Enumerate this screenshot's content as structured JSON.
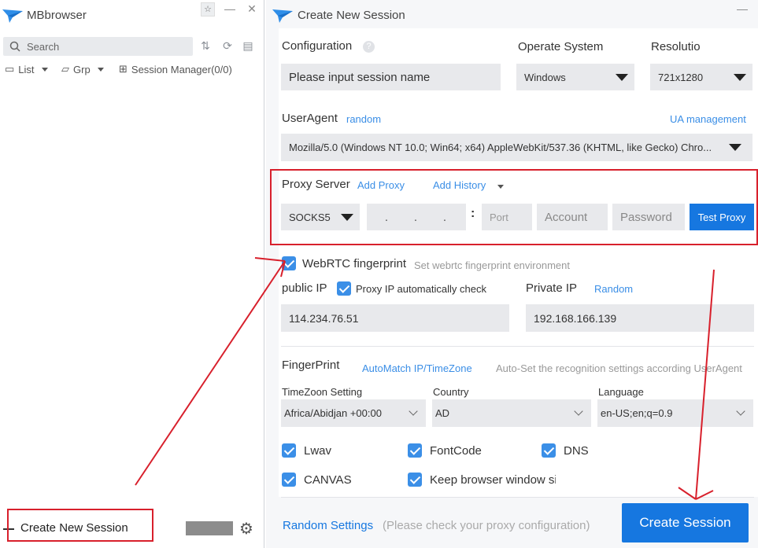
{
  "left": {
    "app_title": "MBbrowser",
    "search_placeholder": "Search",
    "view_list": "List",
    "view_group": "Grp",
    "session_manager": "Session Manager(0/0)",
    "create_new_session": "Create New Session"
  },
  "dialog": {
    "title": "Create New Session",
    "configuration_label": "Configuration",
    "session_name_placeholder": "Please input session name",
    "os_label": "Operate System",
    "os_value": "Windows",
    "resolution_label": "Resolutio",
    "resolution_value": "721x1280",
    "useragent_label": "UserAgent",
    "useragent_random": "random",
    "ua_management": "UA management",
    "useragent_value": "Mozilla/5.0 (Windows NT 10.0; Win64; x64) AppleWebKit/537.36 (KHTML, like Gecko) Chro...",
    "proxy": {
      "label": "Proxy Server",
      "add_proxy": "Add Proxy",
      "add_history": "Add History",
      "type": "SOCKS5",
      "ip_placeholder": ".     .     .",
      "colon": ":",
      "port_placeholder": "Port",
      "account_placeholder": "Account",
      "password_placeholder": "Password",
      "test_button": "Test Proxy"
    },
    "webrtc_label": "WebRTC fingerprint",
    "webrtc_hint": "Set webrtc fingerprint environment",
    "public_ip_label": "public IP",
    "proxy_ip_check": "Proxy IP automatically check",
    "public_ip_value": "114.234.76.51",
    "private_ip_label": "Private IP",
    "private_ip_random": "Random",
    "private_ip_value": "192.168.166.139",
    "fingerprint_label": "FingerPrint",
    "automatch": "AutoMatch IP/TimeZone",
    "autoset_hint": "Auto-Set the recognition settings according UserAgent",
    "timezone_label": "TimeZoon Setting",
    "timezone_value": "Africa/Abidjan +00:00",
    "country_label": "Country",
    "country_value": "AD",
    "language_label": "Language",
    "language_value": "en-US;en;q=0.9",
    "checks": {
      "lwav": "Lwav",
      "fontcode": "FontCode",
      "dns": "DNS",
      "canvas": "CANVAS",
      "keep_window": "Keep browser window si"
    },
    "random_settings": "Random Settings",
    "footer_hint": "(Please check your proxy configuration)",
    "create_button": "Create Session"
  },
  "colors": {
    "accent": "#1677e0",
    "link": "#3a8ee6",
    "annotation_red": "#d8202c"
  }
}
